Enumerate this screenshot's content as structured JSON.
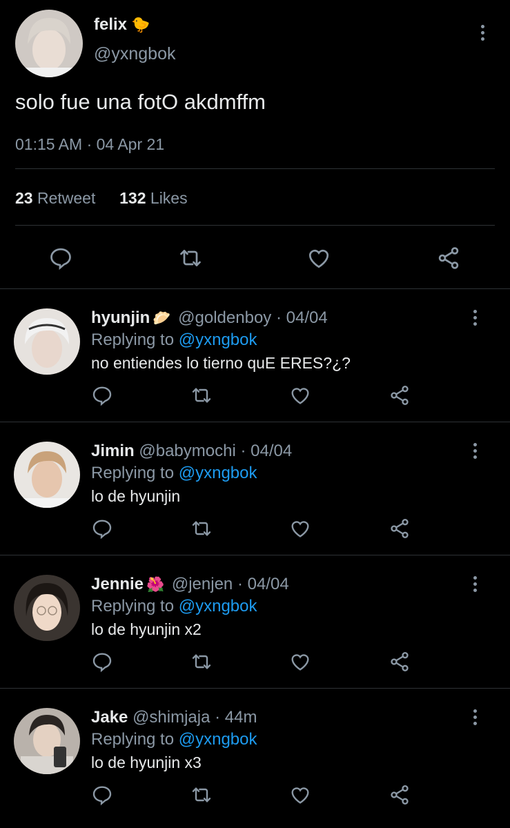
{
  "main_tweet": {
    "name": "felix",
    "name_emoji": "🐤",
    "handle": "@yxngbok",
    "text": "solo fue una fotO akdmffm",
    "time": "01:15 AM",
    "date": "04 Apr 21",
    "retweet_count": "23",
    "retweet_label": "Retweet",
    "like_count": "132",
    "like_label": "Likes"
  },
  "replies": [
    {
      "name": "hyunjin",
      "emoji": "🥟",
      "handle": "@goldenboy",
      "date": "04/04",
      "replying_label": "Replying to",
      "replying_to": "@yxngbok",
      "text": "no entiendes lo tierno quE ERES?¿?"
    },
    {
      "name": "Jimin",
      "emoji": "",
      "handle": "@babymochi",
      "date": "04/04",
      "replying_label": "Replying to",
      "replying_to": "@yxngbok",
      "text": "lo de hyunjin"
    },
    {
      "name": "Jennie",
      "emoji": "🌺",
      "handle": "@jenjen",
      "date": "04/04",
      "replying_label": "Replying to",
      "replying_to": "@yxngbok",
      "text": "lo de hyunjin x2"
    },
    {
      "name": "Jake",
      "emoji": "",
      "handle": "@shimjaja",
      "date": "44m",
      "replying_label": "Replying to",
      "replying_to": "@yxngbok",
      "text": "lo de hyunjin x3"
    }
  ],
  "icons": [
    "reply-icon",
    "retweet-icon",
    "like-icon",
    "share-icon",
    "more-icon"
  ],
  "colors": {
    "background": "#000000",
    "text": "#e7e9ea",
    "muted": "#8b98a5",
    "link": "#1d9bf0",
    "divider": "#2f3336"
  }
}
